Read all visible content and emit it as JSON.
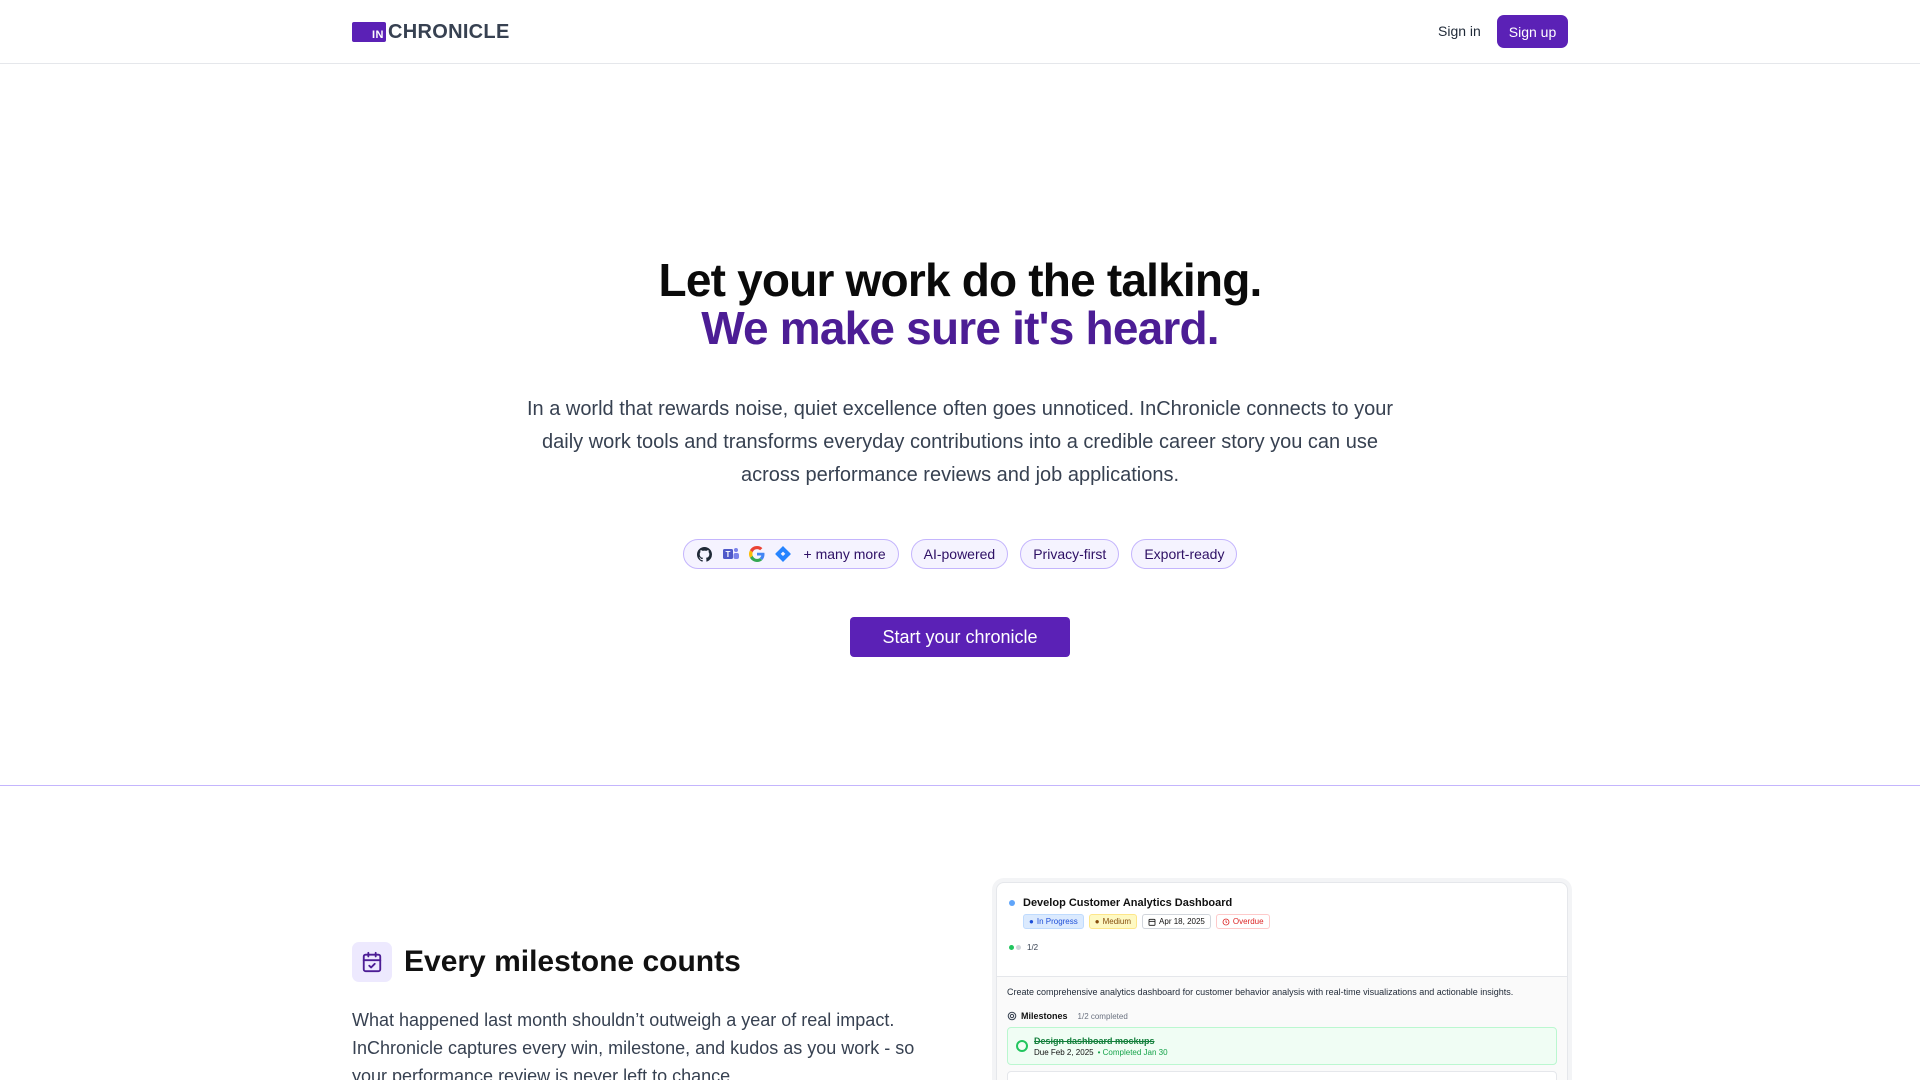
{
  "header": {
    "logo_mark": "IN",
    "logo_text": "CHRONICLE",
    "signin_label": "Sign in",
    "signup_label": "Sign up"
  },
  "hero": {
    "title_line1": "Let your work do the talking.",
    "title_line2": "We make sure it's heard.",
    "description": "In a world that rewards noise, quiet excellence often goes unnoticed. InChronicle connects to your daily work tools and transforms everyday contributions into a credible career story you can use across performance reviews and job applications.",
    "chips": {
      "integrations": {
        "icons": [
          "github-icon",
          "teams-icon",
          "google-icon",
          "jira-icon"
        ],
        "label": "+ many more"
      },
      "ai": "AI-powered",
      "privacy": "Privacy-first",
      "export": "Export-ready"
    },
    "cta_label": "Start your chronicle"
  },
  "feature": {
    "icon": "calendar-check-icon",
    "title": "Every milestone counts",
    "description": "What happened last month shouldn’t outweigh a year of real impact. InChronicle captures every win, milestone, and kudos as you work - so your performance review is never left to chance."
  },
  "mock_card": {
    "task_title": "Develop Customer Analytics Dashboard",
    "badges": {
      "status": "In Progress",
      "priority": "Medium",
      "date": "Apr 18, 2025",
      "overdue": "Overdue"
    },
    "progress": "1/2",
    "description": "Create comprehensive analytics dashboard for customer behavior analysis with real-time visualizations and actionable insights.",
    "milestones_label": "Milestones",
    "milestones_count": "1/2 completed",
    "milestone1": {
      "name": "Design dashboard mockups",
      "due": "Due Feb 2, 2025",
      "completed": "• Completed Jan 30"
    }
  },
  "colors": {
    "brand": "#5b21b6",
    "brand_text": "#4c1d95",
    "chip_bg": "#f5f3ff",
    "chip_border": "#c4b5fd"
  }
}
